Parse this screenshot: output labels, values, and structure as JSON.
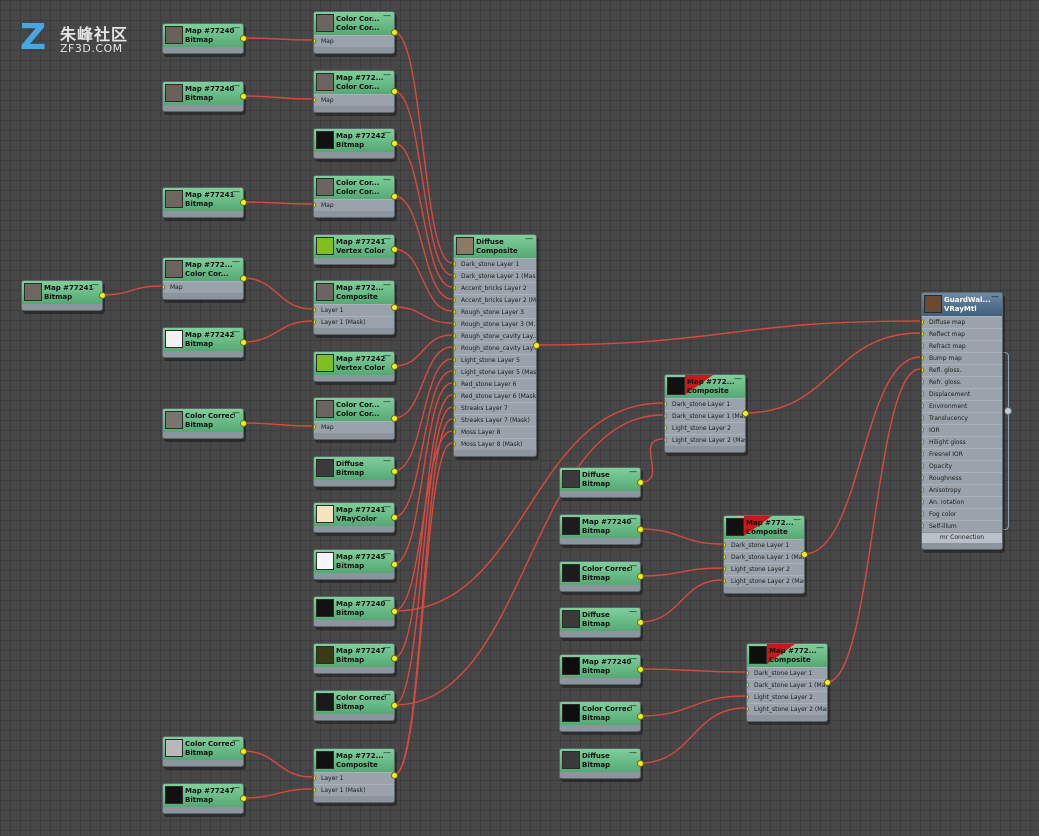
{
  "logo": {
    "chinese": "朱峰社区",
    "english": "ZF3D.COM",
    "mark": "Z"
  },
  "colors": {
    "wire": "#d9483f",
    "socket_on": "#eef21e",
    "node_header": "#5fb37f",
    "material_header": "#4b6b8a"
  },
  "nodes": [
    {
      "id": "n1",
      "title": "Map #772408",
      "subtitle": "Bitmap",
      "thumb": "#6a6259",
      "kind": "map"
    },
    {
      "id": "n2",
      "title": "Color Cor...",
      "subtitle": "Color Cor...",
      "thumb": "#6b6560",
      "kind": "map",
      "slots": [
        "Map"
      ]
    },
    {
      "id": "n3",
      "title": "Map #772408",
      "subtitle": "Bitmap",
      "thumb": "#6a6259",
      "kind": "map"
    },
    {
      "id": "n4",
      "title": "Map #772...",
      "subtitle": "Color Cor...",
      "thumb": "#6b6560",
      "kind": "map",
      "slots": [
        "Map"
      ]
    },
    {
      "id": "n5",
      "title": "Map #772429",
      "subtitle": "Bitmap",
      "thumb": "#111111",
      "kind": "map"
    },
    {
      "id": "n6",
      "title": "Map #772414",
      "subtitle": "Bitmap",
      "thumb": "#6e6760",
      "kind": "map"
    },
    {
      "id": "n7",
      "title": "Color Cor...",
      "subtitle": "Color Cor...",
      "thumb": "#6b6560",
      "kind": "map",
      "slots": [
        "Map"
      ]
    },
    {
      "id": "n8",
      "title": "Map #772413",
      "subtitle": "Vertex Color",
      "thumb": "#7fbf1f",
      "kind": "map"
    },
    {
      "id": "n9",
      "title": "Map #772414",
      "subtitle": "Bitmap",
      "thumb": "#6e6760",
      "kind": "map"
    },
    {
      "id": "n10",
      "title": "Map #772...",
      "subtitle": "Color Cor...",
      "thumb": "#6b6560",
      "kind": "map",
      "slots": [
        "Map"
      ]
    },
    {
      "id": "n11",
      "title": "Map #772...",
      "subtitle": "Composite",
      "thumb": "#6b6560",
      "kind": "map",
      "slots": [
        "Layer 1",
        "Layer 1 (Mask)"
      ]
    },
    {
      "id": "n12",
      "title": "Map #772424",
      "subtitle": "Bitmap",
      "thumb": "#f2f2f2",
      "kind": "map"
    },
    {
      "id": "n13",
      "title": "Map #772420",
      "subtitle": "Vertex Color",
      "thumb": "#7fbf1f",
      "kind": "map"
    },
    {
      "id": "n14",
      "title": "Color Correct...",
      "subtitle": "Bitmap",
      "thumb": "#7a746c",
      "kind": "map"
    },
    {
      "id": "n15",
      "title": "Color Cor...",
      "subtitle": "Color Cor...",
      "thumb": "#6b6560",
      "kind": "map",
      "slots": [
        "Map"
      ]
    },
    {
      "id": "n16",
      "title": "Diffuse",
      "subtitle": "Bitmap",
      "thumb": "#3a3a3a",
      "kind": "map"
    },
    {
      "id": "n17",
      "title": "Map #772410",
      "subtitle": "VRayColor",
      "thumb": "#f6e3c0",
      "kind": "map"
    },
    {
      "id": "n18",
      "title": "Map #772459",
      "subtitle": "Bitmap",
      "thumb": "#f6f6f6",
      "kind": "map"
    },
    {
      "id": "n19",
      "title": "Map #772408",
      "subtitle": "Bitmap",
      "thumb": "#121212",
      "kind": "map"
    },
    {
      "id": "n20",
      "title": "Map #772472",
      "subtitle": "Bitmap",
      "thumb": "#3a3a14",
      "kind": "map"
    },
    {
      "id": "n21",
      "title": "Color Correct...",
      "subtitle": "Bitmap",
      "thumb": "#1a1a1a",
      "kind": "map"
    },
    {
      "id": "n22",
      "title": "Color Correct...",
      "subtitle": "Bitmap",
      "thumb": "#b8b8b8",
      "kind": "map"
    },
    {
      "id": "n23",
      "title": "Map #772...",
      "subtitle": "Composite",
      "thumb": "#111111",
      "kind": "map",
      "slots": [
        "Layer 1",
        "Layer 1 (Mask)"
      ]
    },
    {
      "id": "n24",
      "title": "Map #772475",
      "subtitle": "Bitmap",
      "thumb": "#111111",
      "kind": "map"
    },
    {
      "id": "n25",
      "title": "Diffuse",
      "subtitle": "Composite",
      "thumb": "#8a7a66",
      "kind": "map",
      "slots": [
        "Dark_stone Layer 1",
        "Dark_stone Layer 1 (Mask)",
        "Accent_bricks Layer 2",
        "Accent_bricks Layer 2 (M...",
        "Rough_stone Layer 3",
        "Rough_stone Layer 3 (M...",
        "Rough_stone_cavity Lay...",
        "Rough_stone_cavity Lay...",
        "Light_stone Layer 5",
        "Light_stone Layer 5 (Mask)",
        "Red_stone Layer 6",
        "Red_stone Layer 6 (Mask)",
        "Streaks Layer 7",
        "Streaks Layer 7 (Mask)",
        "Moss Layer 8",
        "Moss Layer 8 (Mask)"
      ]
    },
    {
      "id": "n26",
      "title": "Map #772...",
      "subtitle": "Composite",
      "thumb": "#111111",
      "kind": "map",
      "slots": [
        "Dark_stone Layer 1",
        "Dark_stone Layer 1 (Mask)",
        "Light_stone Layer 2",
        "Light_stone Layer 2 (Mask)"
      ]
    },
    {
      "id": "n27",
      "title": "Diffuse",
      "subtitle": "Bitmap",
      "thumb": "#3a3a3a",
      "kind": "map"
    },
    {
      "id": "n28",
      "title": "Map #772408",
      "subtitle": "Bitmap",
      "thumb": "#1c1c1c",
      "kind": "map"
    },
    {
      "id": "n29",
      "title": "Color Correct...",
      "subtitle": "Bitmap",
      "thumb": "#1c1c1c",
      "kind": "map"
    },
    {
      "id": "n30",
      "title": "Diffuse",
      "subtitle": "Bitmap",
      "thumb": "#3a3a3a",
      "kind": "map"
    },
    {
      "id": "n31",
      "title": "Map #772...",
      "subtitle": "Composite",
      "thumb": "#111111",
      "kind": "map",
      "slots": [
        "Dark_stone Layer 1",
        "Dark_stone Layer 1 (Mask)",
        "Light_stone Layer 2",
        "Light_stone Layer 2 (Mask)"
      ]
    },
    {
      "id": "n32",
      "title": "Map #772408",
      "subtitle": "Bitmap",
      "thumb": "#0e0e0e",
      "kind": "map"
    },
    {
      "id": "n33",
      "title": "Color Correct...",
      "subtitle": "Bitmap",
      "thumb": "#0e0e0e",
      "kind": "map"
    },
    {
      "id": "n34",
      "title": "Diffuse",
      "subtitle": "Bitmap",
      "thumb": "#3a3a3a",
      "kind": "map"
    },
    {
      "id": "n35",
      "title": "Map #772...",
      "subtitle": "Composite",
      "thumb": "#0e0e0e",
      "kind": "map",
      "slots": [
        "Dark_stone Layer 1",
        "Dark_stone Layer 1 (Mask)",
        "Light_stone Layer 2",
        "Light_stone Layer 2 (Mask)"
      ]
    },
    {
      "id": "n36",
      "title": "GuardWal...",
      "subtitle": "VRayMtl",
      "thumb": "#6b4a32",
      "kind": "material",
      "slots": [
        "Diffuse map",
        "Reflect map",
        "Refract map",
        "Bump map",
        "Refl. gloss.",
        "Refr. gloss.",
        "Displacement",
        "Environment",
        "Translucency",
        "IOR",
        "Hilight gloss",
        "Fresnel IOR",
        "Opacity",
        "Roughness",
        "Anisotropy",
        "An. rotation",
        "Fog color",
        "Self-illum"
      ],
      "footer": "mr Connection"
    }
  ]
}
